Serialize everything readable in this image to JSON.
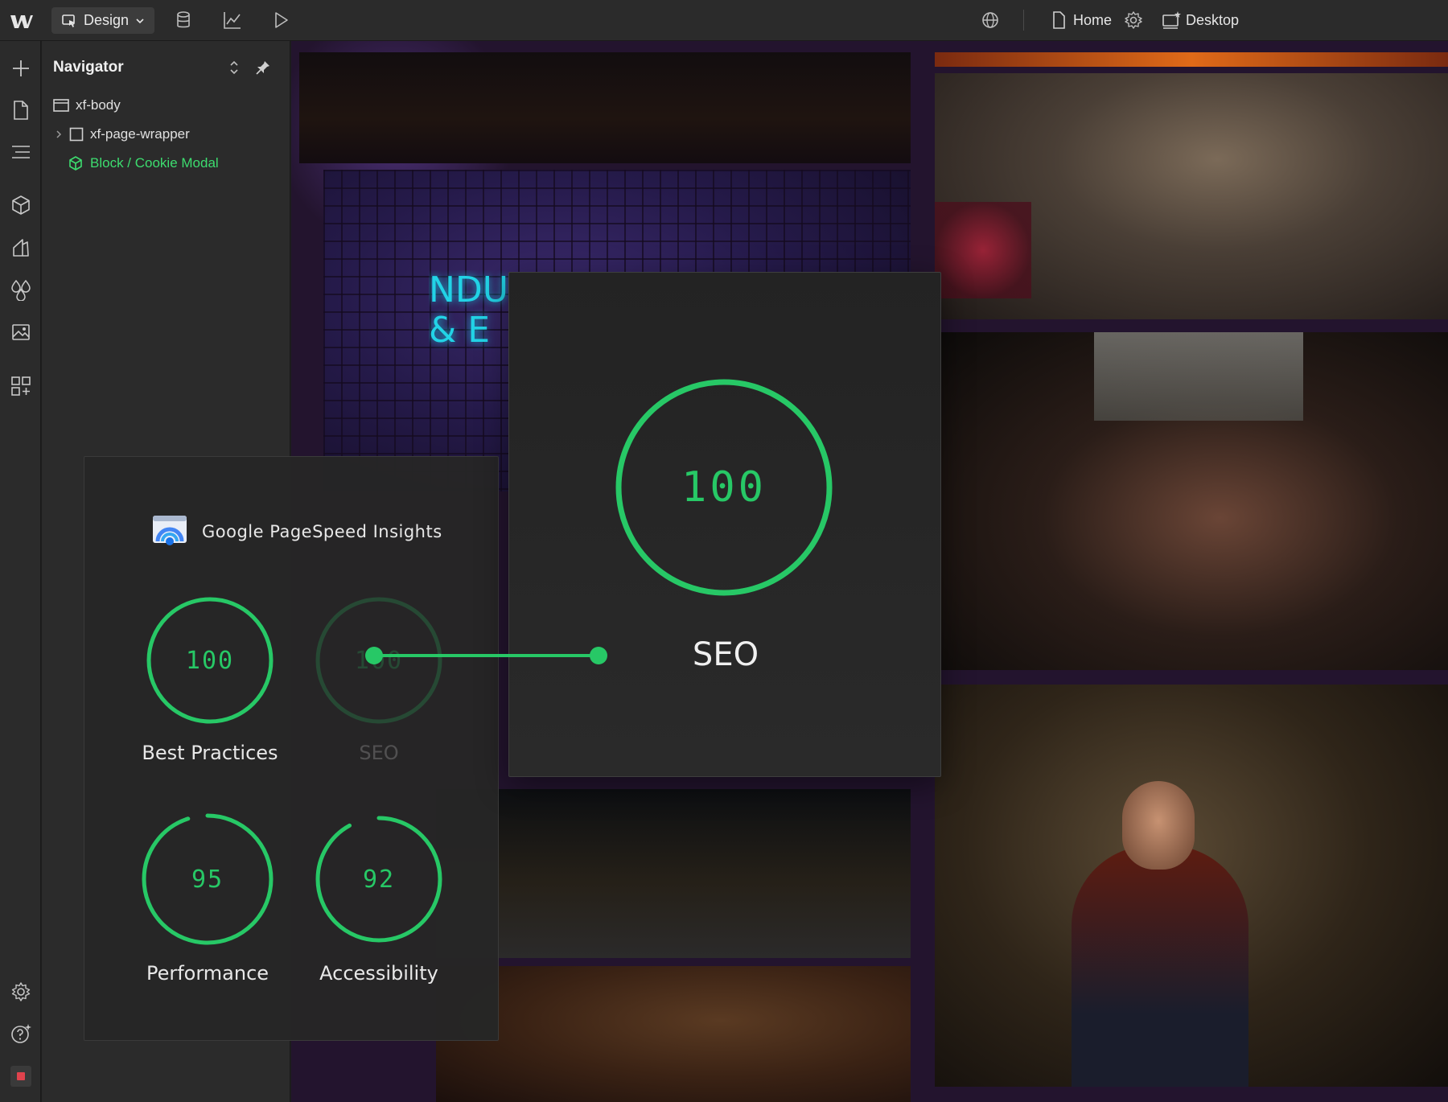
{
  "topbar": {
    "mode_label": "Design",
    "page_label": "Home",
    "breakpoint_label": "Desktop"
  },
  "navigator": {
    "title": "Navigator",
    "items": [
      {
        "label": "xf-body"
      },
      {
        "label": "xf-page-wrapper"
      },
      {
        "label": "Block / Cookie Modal"
      }
    ]
  },
  "canvas": {
    "neon_text": "NDU\n& E"
  },
  "pagespeed": {
    "title": "Google PageSpeed Insights",
    "metrics": [
      {
        "label": "Best Practices",
        "score": "100",
        "value": 1.0
      },
      {
        "label": "SEO",
        "score": "100",
        "value": 1.0
      },
      {
        "label": "Performance",
        "score": "95",
        "value": 0.95
      },
      {
        "label": "Accessibility",
        "score": "92",
        "value": 0.92
      }
    ]
  },
  "seo_detail": {
    "score": "100",
    "value": 1.0,
    "label": "SEO"
  },
  "colors": {
    "accent_green": "#27c866",
    "component_green": "#3ddc6f",
    "panel_bg": "#2b2b2b",
    "canvas_bg": "#23142e"
  },
  "icons": {
    "rail": [
      "add-icon",
      "pages-icon",
      "navigator-icon",
      "components-icon",
      "styles-icon",
      "variables-icon",
      "assets-icon",
      "apps-icon",
      "settings-icon",
      "help-icon",
      "record-icon"
    ],
    "topbar": [
      "webflow-logo-icon",
      "cursor-icon",
      "cms-icon",
      "analytics-icon",
      "preview-icon",
      "globe-icon",
      "page-icon",
      "gear-icon",
      "desktop-icon"
    ]
  }
}
